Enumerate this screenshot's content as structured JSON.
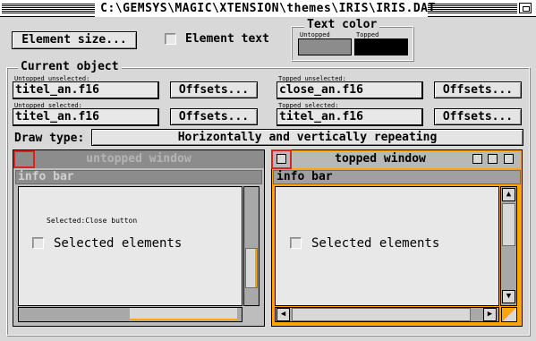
{
  "window": {
    "title": "C:\\GEMSYS\\MAGIC\\XTENSION\\themes\\IRIS\\IRIS.DAT"
  },
  "top": {
    "element_size_label": "Element size...",
    "element_text_label": "Element text",
    "text_color": {
      "title": "Text color",
      "untopped_label": "Untopped",
      "topped_label": "Topped",
      "untopped_color": "#8c8c8c",
      "topped_color": "#000000"
    }
  },
  "current_object": {
    "title": "Current object",
    "fields": [
      {
        "label": "Untopped unselected:",
        "value": "titel_an.f16",
        "button": "Offsets..."
      },
      {
        "label": "Topped unselected:",
        "value": "close_an.f16",
        "button": "Offsets..."
      },
      {
        "label": "Untopped selected:",
        "value": "titel_an.f16",
        "button": "Offsets..."
      },
      {
        "label": "Topped selected:",
        "value": "titel_an.f16",
        "button": "Offsets..."
      }
    ],
    "draw_type_label": "Draw type:",
    "draw_type_value": "Horizontally and vertically repeating"
  },
  "preview_untopped": {
    "title": "untopped window",
    "info": "info bar",
    "status": "Selected:Close button",
    "checkbox_label": "Selected elements"
  },
  "preview_topped": {
    "title": "topped window",
    "info": "info bar",
    "checkbox_label": "Selected elements"
  },
  "colors": {
    "accent": "#ffa500",
    "highlight": "#e02020"
  }
}
